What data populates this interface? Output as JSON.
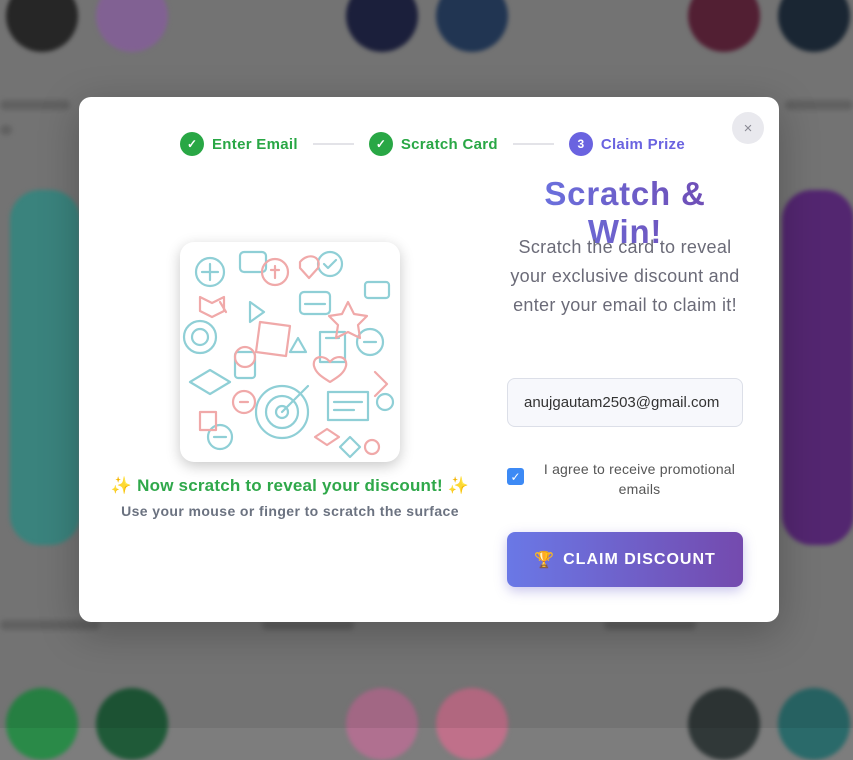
{
  "steps": [
    {
      "label": "Enter Email",
      "marker": "✓",
      "state": "done"
    },
    {
      "label": "Scratch Card",
      "marker": "✓",
      "state": "done"
    },
    {
      "label": "Claim Prize",
      "marker": "3",
      "state": "active"
    }
  ],
  "close_label": "×",
  "scratch": {
    "title": "Now scratch to reveal your discount!",
    "sparkle": "✨",
    "subtitle": "Use your mouse or finger to scratch the surface"
  },
  "heading": "Scratch & Win!",
  "description": "Scratch the card to reveal your exclusive discount and enter your email to claim it!",
  "email": {
    "value": "anujgautam2503@gmail.com",
    "placeholder": ""
  },
  "agree": {
    "checked": true,
    "check_mark": "✓",
    "label": "I agree to receive promotional emails"
  },
  "claim_button": {
    "icon": "🏆",
    "label": "CLAIM DISCOUNT"
  },
  "colors": {
    "success": "#29a745",
    "accent": "#6a63e0",
    "gradient_start": "#6a78e6",
    "gradient_end": "#7046ad"
  },
  "icons": {
    "close": "close-icon",
    "check": "check-icon",
    "trophy": "trophy-icon",
    "sparkle": "sparkle-icon"
  }
}
